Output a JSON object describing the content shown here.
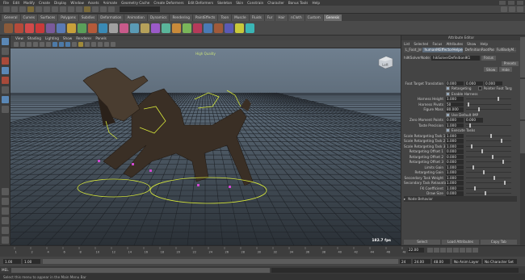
{
  "menubar": {
    "items": [
      "File",
      "Edit",
      "Modify",
      "Create",
      "Display",
      "Window",
      "Assets",
      "Animate",
      "Geometry Cache",
      "Create Deformers",
      "Edit Deformers",
      "Skeleton",
      "Skin",
      "Constrain",
      "Character",
      "Bonus Tools",
      "Help"
    ]
  },
  "shelf_tabs": {
    "items": [
      "General",
      "Curves",
      "Surfaces",
      "Polygons",
      "Subdivs",
      "Deformation",
      "Animation",
      "Dynamics",
      "Rendering",
      "PaintEffects",
      "Toon",
      "Muscle",
      "Fluids",
      "Fur",
      "Hair",
      "nCloth",
      "Custom",
      "Genesis"
    ],
    "active": 17
  },
  "panel_menu": {
    "items": [
      "View",
      "Shading",
      "Lighting",
      "Show",
      "Renderer",
      "Panels"
    ]
  },
  "viewport": {
    "label": "High Quality",
    "fps": "182.7 fps",
    "viewcube": "Left"
  },
  "right_panel": {
    "title": "Attribute Editor",
    "menu": [
      "List",
      "Selected",
      "Focus",
      "Attributes",
      "Show",
      "Help"
    ],
    "tabs": [
      "L_Foot_Jnt",
      "humanIKEffectorHelper1",
      "DefinitionRootPass",
      "FullBodyM..."
    ],
    "active_tab": 1,
    "node_label": "hiIKSolverNode:",
    "node_value": "hikSolverDefinitionIK1",
    "focus_btn": "Focus",
    "presets_btn": "Presets",
    "show_btn": "Show",
    "hide_btn": "Hide"
  },
  "attrs": [
    {
      "type": "field",
      "label": "Foot Target Translation",
      "value": "0.000",
      "value2": "0.000",
      "value3": "0.000"
    },
    {
      "type": "checkpair",
      "label": "Retargeting",
      "label2": "Pointer Foot Targ"
    },
    {
      "type": "check",
      "label": "Enable Harness"
    },
    {
      "type": "slider",
      "label": "Harness Height",
      "value": "1.000"
    },
    {
      "type": "slider",
      "label": "Harness Pivots",
      "value": "50"
    },
    {
      "type": "slider",
      "label": "Figure Mass",
      "value": "80.000"
    },
    {
      "type": "check",
      "label": "Use Default IMP"
    },
    {
      "type": "slider",
      "label": "Zero Moment Points",
      "value": "0.000",
      "value2": "0.000"
    },
    {
      "type": "slider",
      "label": "Taste Precision",
      "value": "1.000"
    },
    {
      "type": "check",
      "label": "Execute Tasks"
    },
    {
      "type": "slider",
      "label": "Scale Retargeting Task 1",
      "value": "1.000"
    },
    {
      "type": "slider",
      "label": "Scale Retargeting Task 2",
      "value": "1.000"
    },
    {
      "type": "slider",
      "label": "Scale Retargeting Task 3",
      "value": "1.000"
    },
    {
      "type": "slider",
      "label": "Retargeting Offset 1",
      "value": "0.000"
    },
    {
      "type": "slider",
      "label": "Retargeting Offset 2",
      "value": "0.000"
    },
    {
      "type": "slider",
      "label": "Retargeting Offset 3",
      "value": "0.000"
    },
    {
      "type": "slider",
      "label": "Limits Gain",
      "value": "1.000"
    },
    {
      "type": "slider",
      "label": "Retargeting Gain",
      "value": "1.000"
    },
    {
      "type": "slider",
      "label": "Secondary Task Weight",
      "value": "1.000"
    },
    {
      "type": "slider",
      "label": "Secondary Task Relaxation",
      "value": "1.000"
    },
    {
      "type": "slider",
      "label": "FK Coefficient",
      "value": "1.000"
    },
    {
      "type": "slider",
      "label": "Draw Size",
      "value": "0.000"
    },
    {
      "type": "section",
      "label": "Node Behavior"
    }
  ],
  "footer": {
    "select": "Select",
    "load": "Load Attributes",
    "copy": "Copy Tab"
  },
  "time": {
    "ticks": [
      "1",
      "2",
      "4",
      "6",
      "8",
      "10",
      "12",
      "14",
      "16",
      "18",
      "20",
      "22",
      "24",
      "26",
      "28",
      "30",
      "32",
      "34",
      "36",
      "38",
      "40",
      "42",
      "44",
      "46",
      "48"
    ],
    "current": "22.00"
  },
  "range": {
    "start": "1.00",
    "inner_start": "1.00",
    "inner_end": "24",
    "end": "24.00",
    "end2": "48.00",
    "anim_layer": "No Anim Layer",
    "char_set": "No Character Set"
  },
  "cmdline": {
    "mode": "MEL"
  },
  "help": {
    "text": "Select this menu to appear in the Main Menu Bar"
  }
}
